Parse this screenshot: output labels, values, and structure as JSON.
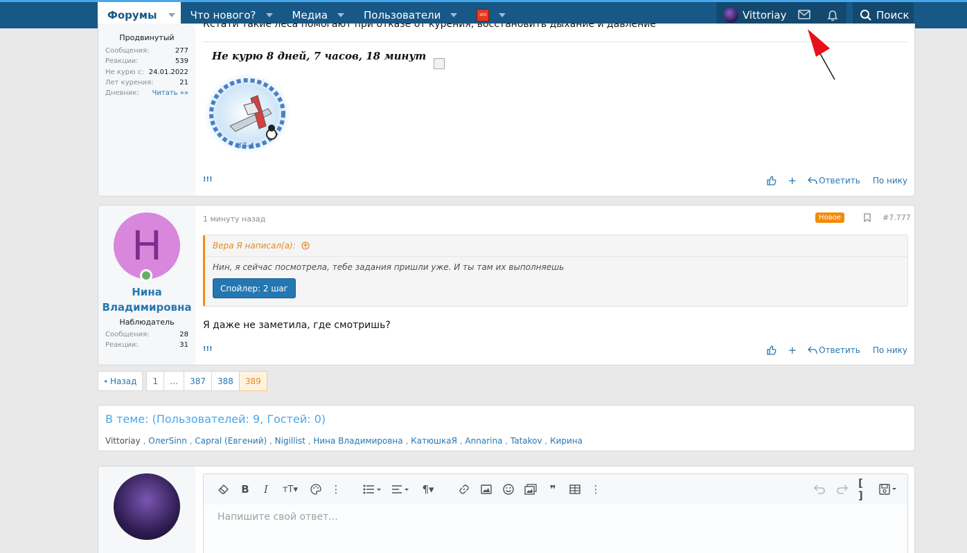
{
  "nav": {
    "tabs": [
      {
        "label": "Форумы"
      },
      {
        "label": "Что нового?"
      },
      {
        "label": "Медиа"
      },
      {
        "label": "Пользователи"
      }
    ],
    "sos_label": "SOS",
    "username": "Vittoriay",
    "search_label": "Поиск"
  },
  "post1": {
    "text": "Кстати такие леса помогают при отказе от курения, восстановить дыхание и давление",
    "signature": "Не курю  8 дней, 7 часов, 18 минут",
    "user_title": "Продвинутый",
    "stats": [
      {
        "label": "Сообщения:",
        "value": "277"
      },
      {
        "label": "Реакции:",
        "value": "539"
      },
      {
        "label": "Не курю с:",
        "value": "24.01.2022"
      },
      {
        "label": "Лет курения:",
        "value": "21"
      },
      {
        "label": "Дневник:",
        "value": "Читать »»"
      }
    ],
    "excl": "!!!",
    "reply_label": "Ответить",
    "bynick_label": "По нику"
  },
  "post2": {
    "avatar_letter": "Н",
    "name": "Нина Владимировна",
    "user_title": "Наблюдатель",
    "stats": [
      {
        "label": "Сообщения:",
        "value": "28"
      },
      {
        "label": "Реакции:",
        "value": "31"
      }
    ],
    "time": "1 минуту назад",
    "badge": "Новое",
    "number": "#7.777",
    "quote_author": "Вера Я написал(а):",
    "quote_text": "Нин, я сейчас посмотрела, тебе задания пришли уже. И ты там их выполняешь",
    "spoiler": "Спойлер: 2 шаг",
    "text": "Я даже не заметила, где смотришь?",
    "excl": "!!!",
    "reply_label": "Ответить",
    "bynick_label": "По нику"
  },
  "pager": {
    "prev": "Назад",
    "pages": [
      "1",
      "…",
      "387",
      "388",
      "389"
    ],
    "current": "389"
  },
  "online": {
    "title": "В теме: (Пользователей: 9, Гостей: 0)",
    "users": [
      "Vittoriay",
      "OлerSinn",
      "Capral (Евгений)",
      "Nigillist",
      "Нина Владимировна",
      "КатюшкаЯ",
      "Annarina",
      "Tatakov",
      "Кирина"
    ]
  },
  "editor": {
    "placeholder": "Напишите свой ответ..."
  },
  "colors": {
    "header": "#185886",
    "accent": "#2577b1",
    "new_badge": "#f28c0c",
    "arrow": "#e8101a"
  }
}
